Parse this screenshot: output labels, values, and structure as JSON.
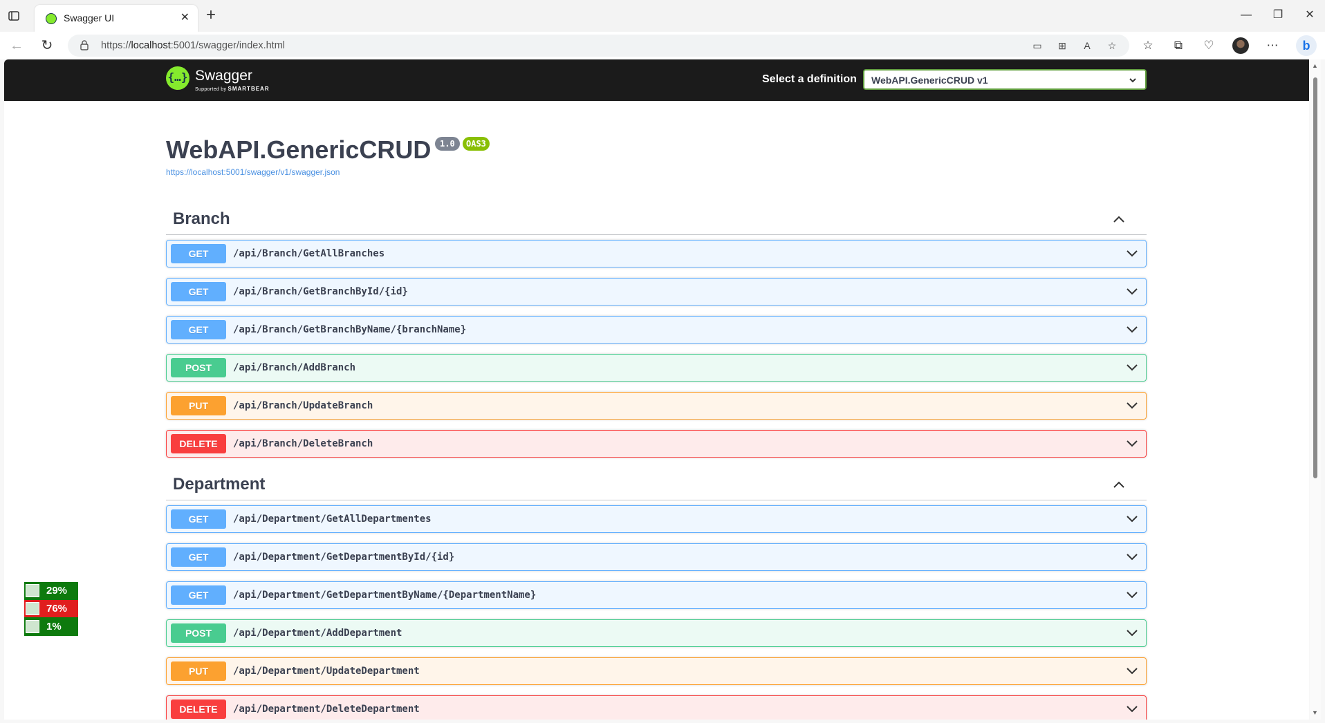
{
  "browser": {
    "tab_title": "Swagger UI",
    "url_host": "https://",
    "url_domain": "localhost",
    "url_rest": ":5001/swagger/index.html"
  },
  "topbar": {
    "logo_name": "Swagger",
    "logo_supported": "Supported by",
    "logo_brand": "SMARTBEAR",
    "definition_label": "Select a definition",
    "definition_value": "WebAPI.GenericCRUD v1"
  },
  "info": {
    "title": "WebAPI.GenericCRUD",
    "version": "1.0",
    "oas": "OAS3",
    "spec_url": "https://localhost:5001/swagger/v1/swagger.json"
  },
  "tags": [
    {
      "name": "Branch",
      "operations": [
        {
          "method": "GET",
          "path": "/api/Branch/GetAllBranches"
        },
        {
          "method": "GET",
          "path": "/api/Branch/GetBranchById/{id}"
        },
        {
          "method": "GET",
          "path": "/api/Branch/GetBranchByName/{branchName}"
        },
        {
          "method": "POST",
          "path": "/api/Branch/AddBranch"
        },
        {
          "method": "PUT",
          "path": "/api/Branch/UpdateBranch"
        },
        {
          "method": "DELETE",
          "path": "/api/Branch/DeleteBranch"
        }
      ]
    },
    {
      "name": "Department",
      "operations": [
        {
          "method": "GET",
          "path": "/api/Department/GetAllDepartmentes"
        },
        {
          "method": "GET",
          "path": "/api/Department/GetDepartmentById/{id}"
        },
        {
          "method": "GET",
          "path": "/api/Department/GetDepartmentByName/{DepartmentName}"
        },
        {
          "method": "POST",
          "path": "/api/Department/AddDepartment"
        },
        {
          "method": "PUT",
          "path": "/api/Department/UpdateDepartment"
        },
        {
          "method": "DELETE",
          "path": "/api/Department/DeleteDepartment"
        }
      ]
    }
  ],
  "monitor": {
    "cpu": "29%",
    "memory": "76%",
    "disk": "1%"
  },
  "colors": {
    "get": "#61affe",
    "post": "#49cc90",
    "put": "#fca130",
    "delete": "#f93e3e",
    "swagger_green": "#85ea2d"
  }
}
